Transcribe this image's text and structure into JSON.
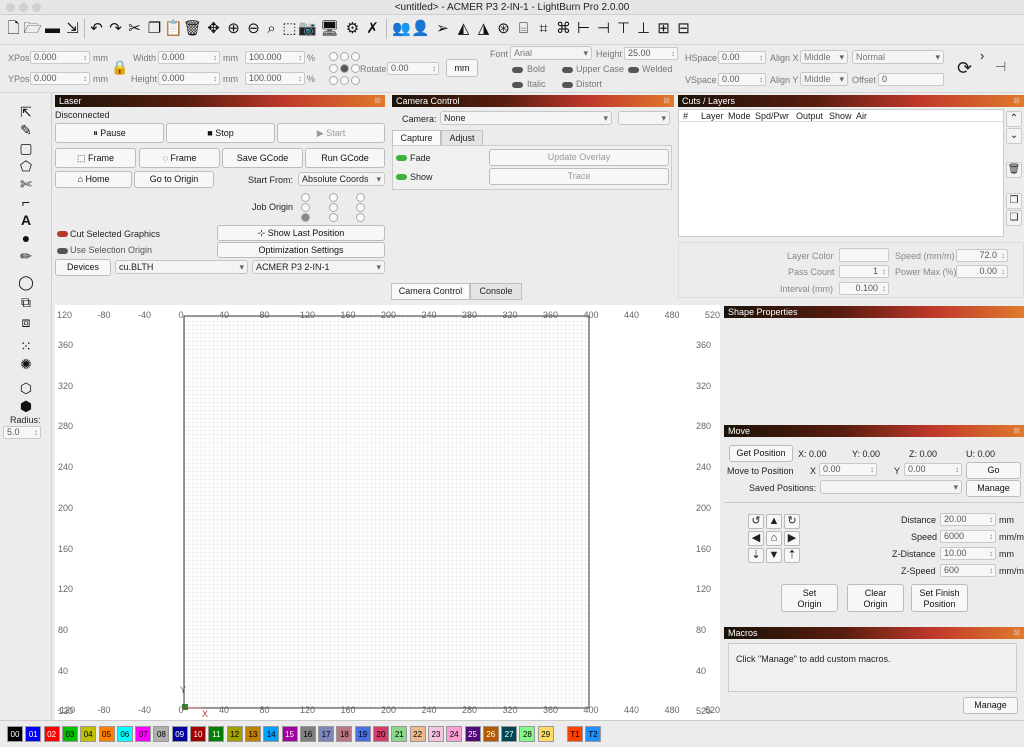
{
  "window": {
    "title": "<untitled> - ACMER P3 2-IN-1 - LightBurn Pro 2.0.00"
  },
  "toolbar": {
    "icons": [
      "new-file",
      "open-folder",
      "save",
      "undo",
      "redo",
      "cut",
      "copy",
      "paste",
      "delete",
      "move",
      "zoom-in",
      "zoom-out",
      "zoom-frame",
      "camera",
      "monitor",
      "settings",
      "tools",
      "user",
      "user-group",
      "send-laser",
      "align",
      "mirror",
      "target",
      "distribute",
      "grid-array",
      "flip",
      "dock"
    ]
  },
  "props": {
    "xpos_label": "XPos",
    "xpos": "0.000",
    "ypos_label": "YPos",
    "ypos": "0.000",
    "unit_mm": "mm",
    "width_label": "Width",
    "width": "0.000",
    "height_label": "Height",
    "height": "0.000",
    "pct_w": "100.000",
    "pct_h": "100.000",
    "pct": "%",
    "rotate_label": "Rotate",
    "rotate": "0.00",
    "mm_button": "mm",
    "font_label": "Font",
    "font_value": "Arial",
    "fheight_label": "Height",
    "fheight": "25.00",
    "bold": "Bold",
    "italic": "Italic",
    "upper": "Upper Case",
    "distort": "Distort",
    "welded": "Welded",
    "hspace_label": "HSpace",
    "hspace": "0.00",
    "vspace_label": "VSpace",
    "vspace": "0.00",
    "alignx_label": "Align X",
    "alignx": "Middle",
    "aligny_label": "Align Y",
    "aligny": "Middle",
    "normal": "Normal",
    "offset_label": "Offset",
    "offset": "0"
  },
  "laser": {
    "title": "Laser",
    "status": "Disconnected",
    "pause": "Pause",
    "stop": "Stop",
    "start": "Start",
    "frame1": "Frame",
    "frame2": "Frame",
    "save_gcode": "Save GCode",
    "run_gcode": "Run GCode",
    "home": "Home",
    "go_origin": "Go to Origin",
    "start_from_label": "Start From:",
    "start_from": "Absolute Coords",
    "job_origin": "Job Origin",
    "cut_selected": "Cut Selected Graphics",
    "use_selection": "Use Selection Origin",
    "show_last": "Show Last Position",
    "optimization": "Optimization Settings",
    "devices": "Devices",
    "port": "cu.BLTH",
    "device": "ACMER P3 2-IN-1"
  },
  "camera": {
    "title": "Camera Control",
    "camera_label": "Camera:",
    "camera_value": "None",
    "tab_capture": "Capture",
    "tab_adjust": "Adjust",
    "fade": "Fade",
    "show": "Show",
    "update_overlay": "Update Overlay",
    "trace": "Trace",
    "bottom_tab_camera": "Camera Control",
    "bottom_tab_console": "Console"
  },
  "cuts": {
    "title": "Cuts / Layers",
    "columns": [
      "#",
      "Layer",
      "Mode",
      "Spd/Pwr",
      "Output",
      "Show",
      "Air"
    ],
    "layer_color": "Layer Color",
    "speed_label": "Speed (mm/m)",
    "speed": "72.0",
    "pass_label": "Pass Count",
    "pass": "1",
    "power_label": "Power Max (%)",
    "power": "0.00",
    "interval_label": "Interval (mm)",
    "interval": "0.100"
  },
  "shape": {
    "title": "Shape Properties"
  },
  "move": {
    "title": "Move",
    "get_position": "Get Position",
    "x_read": "X: 0.00",
    "y_read": "Y: 0.00",
    "z_read": "Z: 0.00",
    "u_read": "U: 0.00",
    "move_to": "Move to Position",
    "x_label": "X",
    "x_val": "0.00",
    "y_label": "Y",
    "y_val": "0.00",
    "go": "Go",
    "saved_label": "Saved Positions:",
    "manage": "Manage",
    "distance_label": "Distance",
    "distance": "20.00",
    "dist_unit": "mm",
    "speed_label": "Speed",
    "speed": "6000",
    "speed_unit": "mm/m",
    "zdist_label": "Z-Distance",
    "zdist": "10.00",
    "zdist_unit": "mm",
    "zspeed_label": "Z-Speed",
    "zspeed": "600",
    "zspeed_unit": "mm/m",
    "set_origin_1": "Set",
    "set_origin_2": "Origin",
    "clear_origin_1": "Clear",
    "clear_origin_2": "Origin",
    "set_finish_1": "Set Finish",
    "set_finish_2": "Position"
  },
  "macros": {
    "title": "Macros",
    "hint": "Click \"Manage\" to add custom macros.",
    "manage": "Manage"
  },
  "left": {
    "radius_label": "Radius:",
    "radius": "5.0"
  },
  "ruler": {
    "top": [
      "120",
      "-80",
      "-40",
      "0",
      "40",
      "80",
      "120",
      "160",
      "200",
      "240",
      "280",
      "320",
      "360",
      "400",
      "440",
      "480",
      "520"
    ],
    "left": [
      "360",
      "320",
      "280",
      "240",
      "200",
      "160",
      "120",
      "80",
      "40",
      "120"
    ],
    "right": [
      "360",
      "320",
      "280",
      "240",
      "200",
      "160",
      "120",
      "80",
      "40",
      "520"
    ],
    "bottom": [
      "-120",
      "-80",
      "-40",
      "0",
      "40",
      "80",
      "120",
      "160",
      "200",
      "240",
      "280",
      "320",
      "360",
      "400",
      "440",
      "480",
      "520"
    ],
    "x_axis": "X",
    "y_axis": "Y"
  },
  "palette": [
    {
      "label": "00",
      "color": "#000000",
      "fg": "#ffffff"
    },
    {
      "label": "01",
      "color": "#0000ff",
      "fg": "#ffffff"
    },
    {
      "label": "02",
      "color": "#ff0000",
      "fg": "#ffffff"
    },
    {
      "label": "03",
      "color": "#00c000",
      "fg": "#000000"
    },
    {
      "label": "04",
      "color": "#c0c000",
      "fg": "#000000"
    },
    {
      "label": "05",
      "color": "#ff8000",
      "fg": "#000000"
    },
    {
      "label": "06",
      "color": "#00ffff",
      "fg": "#000000"
    },
    {
      "label": "07",
      "color": "#ff00ff",
      "fg": "#000000"
    },
    {
      "label": "08",
      "color": "#b0b0b0",
      "fg": "#000000"
    },
    {
      "label": "09",
      "color": "#0000a0",
      "fg": "#ffffff"
    },
    {
      "label": "10",
      "color": "#a00000",
      "fg": "#ffffff"
    },
    {
      "label": "11",
      "color": "#008000",
      "fg": "#ffffff"
    },
    {
      "label": "12",
      "color": "#a0a000",
      "fg": "#000000"
    },
    {
      "label": "13",
      "color": "#c08000",
      "fg": "#000000"
    },
    {
      "label": "14",
      "color": "#00a0ff",
      "fg": "#000000"
    },
    {
      "label": "15",
      "color": "#a000a0",
      "fg": "#ffffff"
    },
    {
      "label": "16",
      "color": "#808080",
      "fg": "#000000"
    },
    {
      "label": "17",
      "color": "#7d87b9",
      "fg": "#000000"
    },
    {
      "label": "18",
      "color": "#bb7784",
      "fg": "#000000"
    },
    {
      "label": "19",
      "color": "#4a6fe3",
      "fg": "#000000"
    },
    {
      "label": "20",
      "color": "#d33f6a",
      "fg": "#000000"
    },
    {
      "label": "21",
      "color": "#8cd78c",
      "fg": "#000000"
    },
    {
      "label": "22",
      "color": "#f0b98d",
      "fg": "#000000"
    },
    {
      "label": "23",
      "color": "#f6c4e1",
      "fg": "#000000"
    },
    {
      "label": "24",
      "color": "#fa9ed4",
      "fg": "#000000"
    },
    {
      "label": "25",
      "color": "#500a78",
      "fg": "#ffffff"
    },
    {
      "label": "26",
      "color": "#b45a00",
      "fg": "#ffffff"
    },
    {
      "label": "27",
      "color": "#004754",
      "fg": "#ffffff"
    },
    {
      "label": "28",
      "color": "#86fa88",
      "fg": "#000000"
    },
    {
      "label": "29",
      "color": "#ffdb66",
      "fg": "#000000"
    },
    {
      "label": "T1",
      "color": "#ff4000",
      "fg": "#000000"
    },
    {
      "label": "T2",
      "color": "#1e90ff",
      "fg": "#000000"
    }
  ]
}
